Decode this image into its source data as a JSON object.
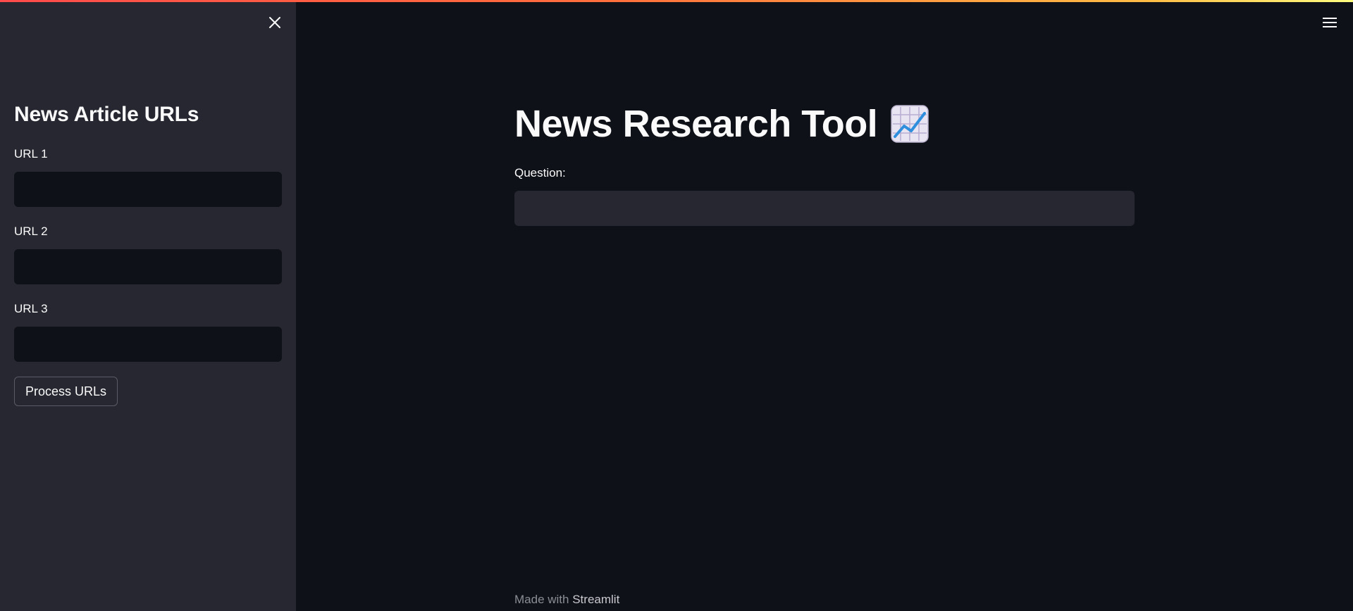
{
  "colors": {
    "sidebar_bg": "#262730",
    "main_bg": "#0e1117",
    "text": "#fafafa",
    "accent_gradient": [
      "#ff4b4b",
      "#ffbd45",
      "#fffd80"
    ]
  },
  "sidebar": {
    "close_icon": "close-icon",
    "title": "News Article URLs",
    "fields": [
      {
        "label": "URL 1",
        "value": "",
        "placeholder": ""
      },
      {
        "label": "URL 2",
        "value": "",
        "placeholder": ""
      },
      {
        "label": "URL 3",
        "value": "",
        "placeholder": ""
      }
    ],
    "process_button": "Process URLs"
  },
  "main": {
    "menu_icon": "hamburger-menu-icon",
    "title": "News Research Tool",
    "title_icon": "chart-increasing-icon",
    "question_label": "Question:",
    "question_value": "",
    "question_placeholder": ""
  },
  "footer": {
    "prefix": "Made with",
    "brand": "Streamlit"
  }
}
